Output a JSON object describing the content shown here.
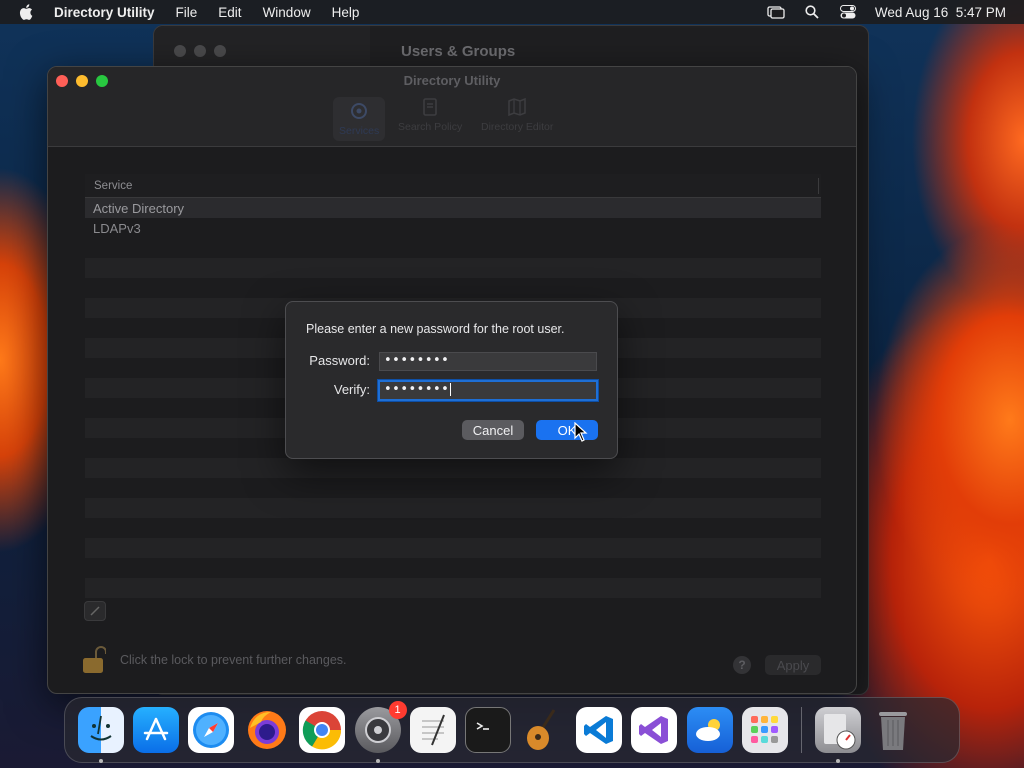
{
  "menubar": {
    "app_name": "Directory Utility",
    "menus": [
      "File",
      "Edit",
      "Window",
      "Help"
    ],
    "datetime": "Wed Aug 16  5:47 PM"
  },
  "background_window": {
    "title": "Users & Groups"
  },
  "window": {
    "title": "Directory Utility",
    "toolbar_tabs": [
      "Services",
      "Search Policy",
      "Directory Editor"
    ],
    "active_tab": "Services",
    "table": {
      "column_header": "Service",
      "rows": [
        "Active Directory",
        "LDAPv3"
      ],
      "selected_row": "Active Directory"
    },
    "lock_text": "Click the lock to prevent further changes.",
    "help_label": "?",
    "apply_label": "Apply"
  },
  "dialog": {
    "prompt": "Please enter a new password for the root user.",
    "password_label": "Password:",
    "password_value": "••••••••",
    "verify_label": "Verify:",
    "verify_value": "••••••••",
    "cancel_label": "Cancel",
    "ok_label": "OK"
  },
  "dock": {
    "items": [
      "Finder",
      "App Store",
      "Safari",
      "Firefox",
      "Chrome",
      "System Settings",
      "TextEdit",
      "Terminal",
      "GarageBand",
      "Visual Studio Code",
      "Visual Studio",
      "Weather",
      "Launchpad",
      "Directory Utility",
      "Trash"
    ],
    "system_settings_badge": "1"
  },
  "colors": {
    "accent": "#1a72f0",
    "close": "#ff5f57",
    "minimize": "#febc2e",
    "zoom": "#28c840",
    "badge": "#ff3b30"
  }
}
